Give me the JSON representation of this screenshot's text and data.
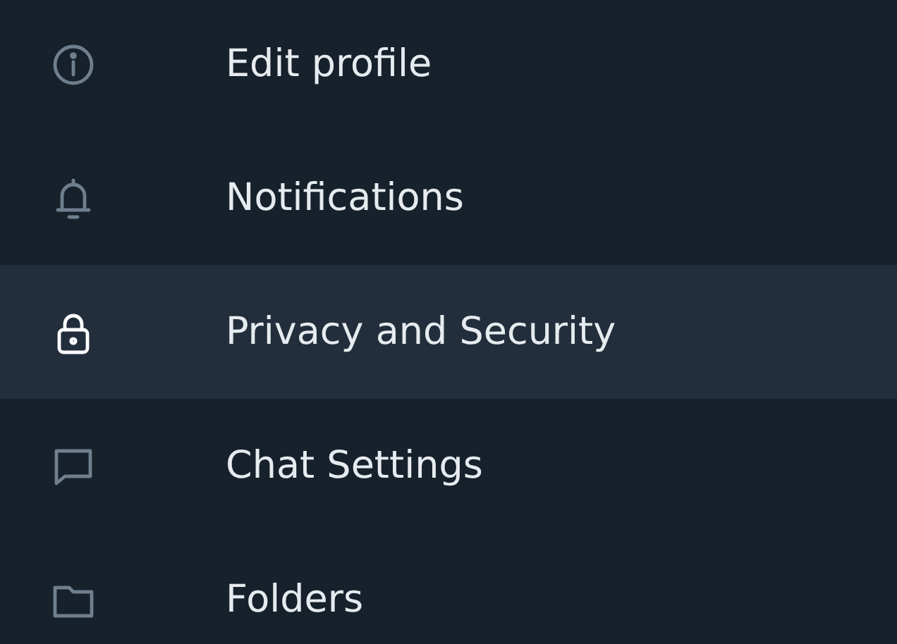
{
  "menu": {
    "items": [
      {
        "label": "Edit profile",
        "selected": false
      },
      {
        "label": "Notifications",
        "selected": false
      },
      {
        "label": "Privacy and Security",
        "selected": true
      },
      {
        "label": "Chat Settings",
        "selected": false
      },
      {
        "label": "Folders",
        "selected": false
      }
    ]
  }
}
